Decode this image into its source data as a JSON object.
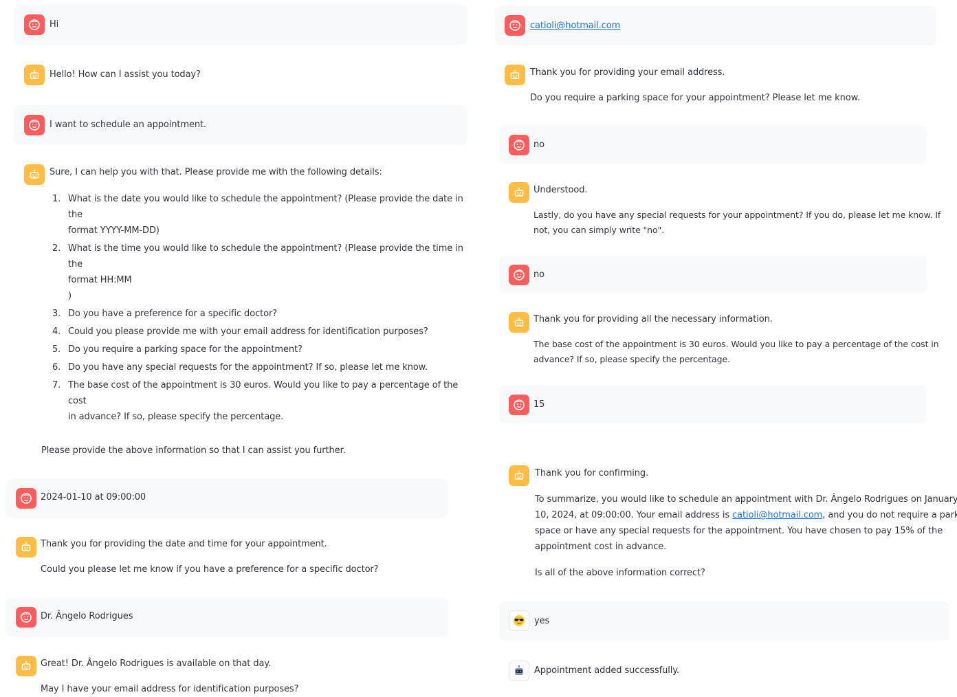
{
  "colors": {
    "user_avatar": "#ff5d5d",
    "bot_avatar": "#ffbd45",
    "user_bubble": "#f8f9fb",
    "link": "#1a73e8",
    "text": "#31333f"
  },
  "left": {
    "m1": "Hi",
    "m2": "Hello! How can I assist you today?",
    "m3": "I want to schedule an appointment.",
    "m4": {
      "intro": "Sure, I can help you with that. Please provide me with the following details:",
      "items": [
        {
          "num": "1.",
          "line1": "What is the date you would like to schedule the appointment? (Please provide the date in the",
          "line2": "format YYYY-MM-DD)"
        },
        {
          "num": "2.",
          "line1": "What is the time you would like to schedule the appointment? (Please provide the time in the",
          "line2": "format HH:MM",
          "line3": ")"
        },
        {
          "num": "3.",
          "line1": "Do you have a preference for a specific doctor?"
        },
        {
          "num": "4.",
          "line1": "Could you please provide me with your email address for identification purposes?"
        },
        {
          "num": "5.",
          "line1": "Do you require a parking space for the appointment?"
        },
        {
          "num": "6.",
          "line1": "Do you have any special requests for the appointment? If so, please let me know."
        },
        {
          "num": "7.",
          "line1": "The base cost of the appointment is 30 euros. Would you like to pay a percentage of the cost",
          "line2": "in advance? If so, please specify the percentage."
        }
      ],
      "outro": "Please provide the above information so that I can assist you further."
    },
    "m5": "2024-01-10 at 09:00:00",
    "m6": {
      "p1": "Thank you for providing the date and time for your appointment.",
      "p2": "Could you please let me know if you have a preference for a specific doctor?"
    },
    "m7": "Dr. Ângelo Rodrigues",
    "m8": {
      "p1": "Great! Dr. Ângelo Rodrigues is available on that day.",
      "p2": "May I have your email address for identification purposes?"
    }
  },
  "right": {
    "m1": "catioli@hotmail.com",
    "m2": {
      "p1": "Thank you for providing your email address.",
      "p2": "Do you require a parking space for your appointment? Please let me know."
    },
    "m3": "no",
    "m4": {
      "p1": "Understood.",
      "p2a": "Lastly, do you have any special requests for your appointment? If you do, please let me know. If",
      "p2b": "not, you can simply write \"no\"."
    },
    "m5": "no",
    "m6": {
      "p1": "Thank you for providing all the necessary information.",
      "p2a": "The base cost of the appointment is 30 euros. Would you like to pay a percentage of the cost in",
      "p2b": "advance? If so, please specify the percentage."
    },
    "m7": "15",
    "m8": {
      "p1": "Thank you for confirming.",
      "l1": "To summarize, you would like to schedule an appointment with Dr. Ângelo Rodrigues on January",
      "l2a": "10, 2024, at 09:00:00. Your email address is ",
      "l2link": "catioli@hotmail.com",
      "l2b": ", and you do not require a parking",
      "l3": "space or have any special requests for the appointment. You have chosen to pay 15% of the",
      "l4": "appointment cost in advance.",
      "p3": "Is all of the above information correct?"
    },
    "m9": "yes",
    "m10": "Appointment added successfully."
  }
}
